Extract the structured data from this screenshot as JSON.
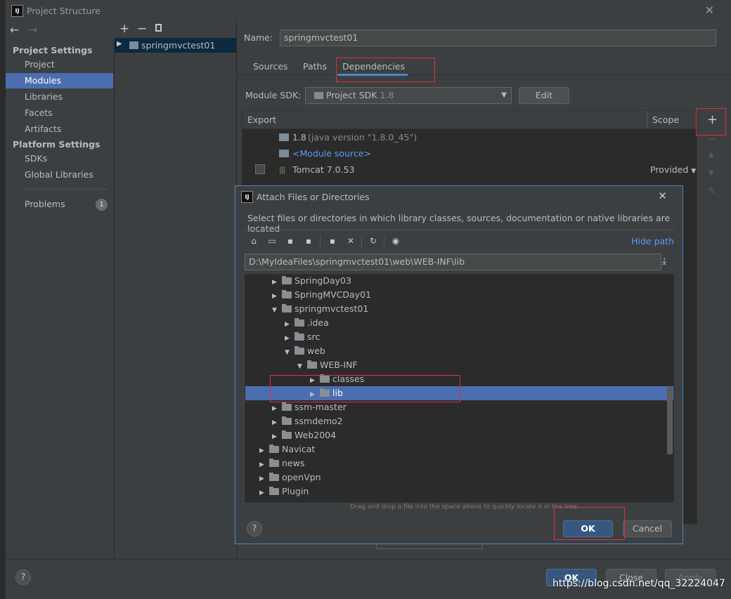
{
  "window": {
    "title": "Project Structure"
  },
  "nav": {
    "back": "←",
    "forward": "→"
  },
  "sidebar": {
    "project_settings_header": "Project Settings",
    "project_items": [
      "Project",
      "Modules",
      "Libraries",
      "Facets",
      "Artifacts"
    ],
    "platform_settings_header": "Platform Settings",
    "platform_items": [
      "SDKs",
      "Global Libraries"
    ],
    "problems_label": "Problems",
    "problems_count": "1"
  },
  "tree": {
    "module_name": "springmvctest01"
  },
  "module": {
    "name_label": "Name:",
    "name_value": "springmvctest01",
    "tabs": [
      "Sources",
      "Paths",
      "Dependencies"
    ],
    "active_tab": "Dependencies",
    "sdk_label": "Module SDK:",
    "sdk_value": "Project SDK",
    "sdk_version": "1.8",
    "edit_label": "Edit",
    "table_headers": {
      "export": "Export",
      "scope": "Scope"
    },
    "deps": [
      {
        "name": "1.8",
        "detail": "(java version \"1.8.0_45\")"
      },
      {
        "name": "<Module source>",
        "detail": ""
      },
      {
        "name": "Tomcat 7.0.53",
        "detail": "",
        "scope": "Provided"
      }
    ]
  },
  "dialog": {
    "title": "Attach Files or Directories",
    "description": "Select files or directories in which library classes, sources, documentation or native libraries are located",
    "hide_path": "Hide path",
    "path_value": "D:\\MyIdeaFiles\\springmvctest01\\web\\WEB-INF\\lib",
    "tree_rows": [
      {
        "label": "SpringDay03",
        "arrow": "▶"
      },
      {
        "label": "SpringMVCDay01",
        "arrow": "▶"
      },
      {
        "label": "springmvctest01",
        "arrow": "▼"
      },
      {
        "label": ".idea",
        "arrow": "▶"
      },
      {
        "label": "src",
        "arrow": "▶"
      },
      {
        "label": "web",
        "arrow": "▼"
      },
      {
        "label": "WEB-INF",
        "arrow": "▼"
      },
      {
        "label": "classes",
        "arrow": "▶"
      },
      {
        "label": "lib",
        "arrow": "▶"
      },
      {
        "label": "ssm-master",
        "arrow": "▶"
      },
      {
        "label": "ssmdemo2",
        "arrow": "▶"
      },
      {
        "label": "Web2004",
        "arrow": "▶"
      },
      {
        "label": "Navicat",
        "arrow": "▶"
      },
      {
        "label": "news",
        "arrow": "▶"
      },
      {
        "label": "openVpn",
        "arrow": "▶"
      },
      {
        "label": "Plugin",
        "arrow": "▶"
      }
    ],
    "drag_hint": "Drag and drop a file into the space above to quickly locate it in the tree",
    "ok_label": "OK",
    "cancel_label": "Cancel",
    "help": "?"
  },
  "footer": {
    "ok_label": "OK",
    "close_label": "Close",
    "apply_label": "Apply",
    "help": "?"
  },
  "watermark": "https://blog.csdn.net/qq_32224047"
}
